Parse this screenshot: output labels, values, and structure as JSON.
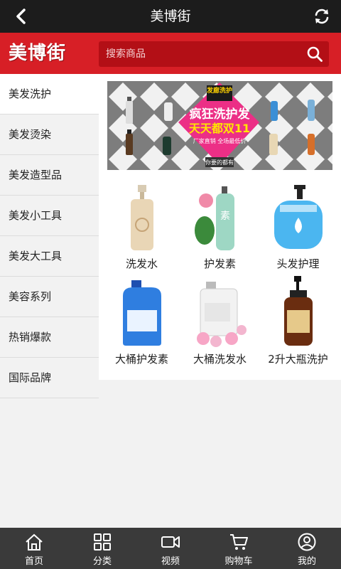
{
  "header": {
    "title": "美博街"
  },
  "brand": {
    "logo_text": "美博街",
    "search_placeholder": "搜索商品"
  },
  "sidebar": {
    "items": [
      {
        "label": "美发洗护"
      },
      {
        "label": "美发烫染"
      },
      {
        "label": "美发造型品"
      },
      {
        "label": "美发小工具"
      },
      {
        "label": "美发大工具"
      },
      {
        "label": "美容系列"
      },
      {
        "label": "热销爆款"
      },
      {
        "label": "国际品牌"
      }
    ]
  },
  "banner": {
    "badge": "发廊洗护",
    "headline_1": "疯狂洗护发",
    "headline_2": "天天都双11",
    "subline": "厂家直销 全场最低价",
    "footer": "你要的都有"
  },
  "products": [
    {
      "name": "洗发水"
    },
    {
      "name": "护发素"
    },
    {
      "name": "头发护理"
    },
    {
      "name": "大桶护发素"
    },
    {
      "name": "大桶洗发水"
    },
    {
      "name": "2升大瓶洗护"
    }
  ],
  "tabbar": {
    "items": [
      {
        "label": "首页",
        "icon": "home-icon"
      },
      {
        "label": "分类",
        "icon": "grid-icon"
      },
      {
        "label": "视频",
        "icon": "video-icon"
      },
      {
        "label": "购物车",
        "icon": "cart-icon"
      },
      {
        "label": "我的",
        "icon": "user-icon"
      }
    ]
  },
  "colors": {
    "topbar": "#1c1c1c",
    "brand_red": "#d71f26",
    "search_bg": "#b30f16",
    "tabbar": "#3a3a3a"
  }
}
